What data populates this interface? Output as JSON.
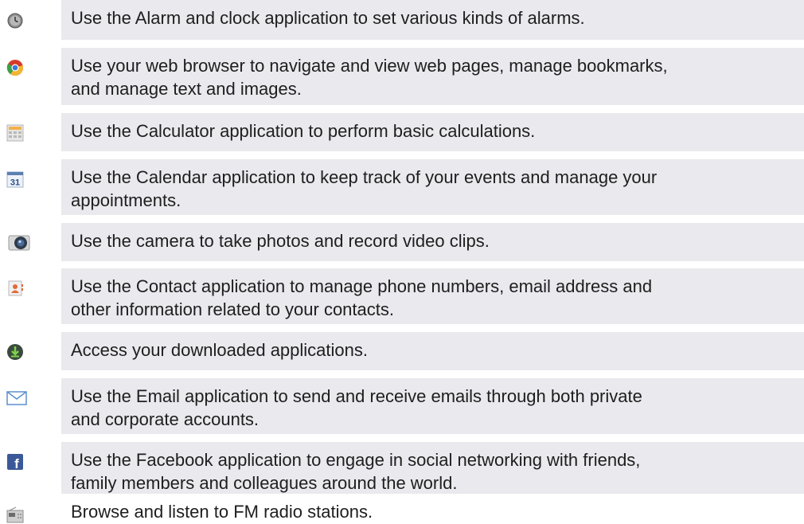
{
  "apps": [
    {
      "icon": "clock-icon",
      "lines": [
        "Use the Alarm and clock application to set various kinds of alarms."
      ]
    },
    {
      "icon": "browser-icon",
      "lines": [
        "Use your web browser to navigate and view web pages, manage bookmarks,",
        "and manage text and images."
      ]
    },
    {
      "icon": "calculator-icon",
      "lines": [
        "Use the Calculator application to perform basic calculations."
      ]
    },
    {
      "icon": "calendar-icon",
      "lines": [
        "Use the Calendar application to keep track of your events and manage your",
        "appointments."
      ]
    },
    {
      "icon": "camera-icon",
      "lines": [
        "Use the camera to take photos and record video clips."
      ]
    },
    {
      "icon": "contacts-icon",
      "lines": [
        "Use the Contact application to manage phone numbers, email address and",
        "other information related to your contacts."
      ]
    },
    {
      "icon": "download-icon",
      "lines": [
        "Access your downloaded applications."
      ]
    },
    {
      "icon": "email-icon",
      "lines": [
        "Use the Email application to send and receive emails through both private",
        "and corporate accounts."
      ]
    },
    {
      "icon": "facebook-icon",
      "lines": [
        "Use the Facebook application to engage in social networking with friends,",
        "family members and colleagues around the world."
      ]
    },
    {
      "icon": "fm-radio-icon",
      "lines": [
        "Browse and listen to FM radio stations."
      ]
    }
  ],
  "calendar_icon_text": "31",
  "facebook_icon_text": "f"
}
